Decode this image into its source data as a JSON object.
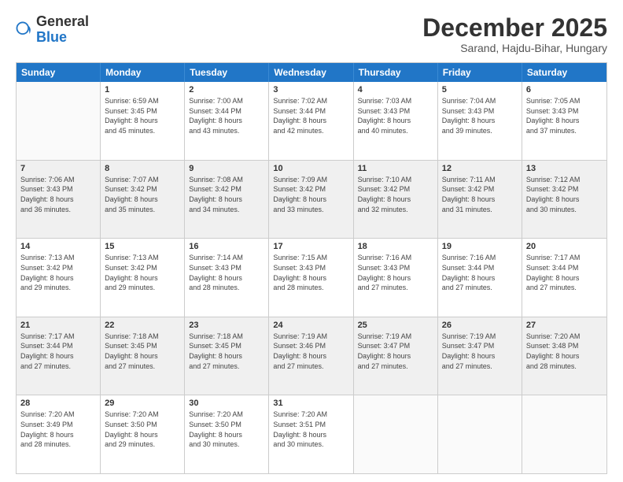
{
  "logo": {
    "general": "General",
    "blue": "Blue"
  },
  "header": {
    "month": "December 2025",
    "location": "Sarand, Hajdu-Bihar, Hungary"
  },
  "weekdays": [
    "Sunday",
    "Monday",
    "Tuesday",
    "Wednesday",
    "Thursday",
    "Friday",
    "Saturday"
  ],
  "weeks": [
    [
      {
        "day": "",
        "info": ""
      },
      {
        "day": "1",
        "info": "Sunrise: 6:59 AM\nSunset: 3:45 PM\nDaylight: 8 hours\nand 45 minutes."
      },
      {
        "day": "2",
        "info": "Sunrise: 7:00 AM\nSunset: 3:44 PM\nDaylight: 8 hours\nand 43 minutes."
      },
      {
        "day": "3",
        "info": "Sunrise: 7:02 AM\nSunset: 3:44 PM\nDaylight: 8 hours\nand 42 minutes."
      },
      {
        "day": "4",
        "info": "Sunrise: 7:03 AM\nSunset: 3:43 PM\nDaylight: 8 hours\nand 40 minutes."
      },
      {
        "day": "5",
        "info": "Sunrise: 7:04 AM\nSunset: 3:43 PM\nDaylight: 8 hours\nand 39 minutes."
      },
      {
        "day": "6",
        "info": "Sunrise: 7:05 AM\nSunset: 3:43 PM\nDaylight: 8 hours\nand 37 minutes."
      }
    ],
    [
      {
        "day": "7",
        "info": "Sunrise: 7:06 AM\nSunset: 3:43 PM\nDaylight: 8 hours\nand 36 minutes."
      },
      {
        "day": "8",
        "info": "Sunrise: 7:07 AM\nSunset: 3:42 PM\nDaylight: 8 hours\nand 35 minutes."
      },
      {
        "day": "9",
        "info": "Sunrise: 7:08 AM\nSunset: 3:42 PM\nDaylight: 8 hours\nand 34 minutes."
      },
      {
        "day": "10",
        "info": "Sunrise: 7:09 AM\nSunset: 3:42 PM\nDaylight: 8 hours\nand 33 minutes."
      },
      {
        "day": "11",
        "info": "Sunrise: 7:10 AM\nSunset: 3:42 PM\nDaylight: 8 hours\nand 32 minutes."
      },
      {
        "day": "12",
        "info": "Sunrise: 7:11 AM\nSunset: 3:42 PM\nDaylight: 8 hours\nand 31 minutes."
      },
      {
        "day": "13",
        "info": "Sunrise: 7:12 AM\nSunset: 3:42 PM\nDaylight: 8 hours\nand 30 minutes."
      }
    ],
    [
      {
        "day": "14",
        "info": "Sunrise: 7:13 AM\nSunset: 3:42 PM\nDaylight: 8 hours\nand 29 minutes."
      },
      {
        "day": "15",
        "info": "Sunrise: 7:13 AM\nSunset: 3:42 PM\nDaylight: 8 hours\nand 29 minutes."
      },
      {
        "day": "16",
        "info": "Sunrise: 7:14 AM\nSunset: 3:43 PM\nDaylight: 8 hours\nand 28 minutes."
      },
      {
        "day": "17",
        "info": "Sunrise: 7:15 AM\nSunset: 3:43 PM\nDaylight: 8 hours\nand 28 minutes."
      },
      {
        "day": "18",
        "info": "Sunrise: 7:16 AM\nSunset: 3:43 PM\nDaylight: 8 hours\nand 27 minutes."
      },
      {
        "day": "19",
        "info": "Sunrise: 7:16 AM\nSunset: 3:44 PM\nDaylight: 8 hours\nand 27 minutes."
      },
      {
        "day": "20",
        "info": "Sunrise: 7:17 AM\nSunset: 3:44 PM\nDaylight: 8 hours\nand 27 minutes."
      }
    ],
    [
      {
        "day": "21",
        "info": "Sunrise: 7:17 AM\nSunset: 3:44 PM\nDaylight: 8 hours\nand 27 minutes."
      },
      {
        "day": "22",
        "info": "Sunrise: 7:18 AM\nSunset: 3:45 PM\nDaylight: 8 hours\nand 27 minutes."
      },
      {
        "day": "23",
        "info": "Sunrise: 7:18 AM\nSunset: 3:45 PM\nDaylight: 8 hours\nand 27 minutes."
      },
      {
        "day": "24",
        "info": "Sunrise: 7:19 AM\nSunset: 3:46 PM\nDaylight: 8 hours\nand 27 minutes."
      },
      {
        "day": "25",
        "info": "Sunrise: 7:19 AM\nSunset: 3:47 PM\nDaylight: 8 hours\nand 27 minutes."
      },
      {
        "day": "26",
        "info": "Sunrise: 7:19 AM\nSunset: 3:47 PM\nDaylight: 8 hours\nand 27 minutes."
      },
      {
        "day": "27",
        "info": "Sunrise: 7:20 AM\nSunset: 3:48 PM\nDaylight: 8 hours\nand 28 minutes."
      }
    ],
    [
      {
        "day": "28",
        "info": "Sunrise: 7:20 AM\nSunset: 3:49 PM\nDaylight: 8 hours\nand 28 minutes."
      },
      {
        "day": "29",
        "info": "Sunrise: 7:20 AM\nSunset: 3:50 PM\nDaylight: 8 hours\nand 29 minutes."
      },
      {
        "day": "30",
        "info": "Sunrise: 7:20 AM\nSunset: 3:50 PM\nDaylight: 8 hours\nand 30 minutes."
      },
      {
        "day": "31",
        "info": "Sunrise: 7:20 AM\nSunset: 3:51 PM\nDaylight: 8 hours\nand 30 minutes."
      },
      {
        "day": "",
        "info": ""
      },
      {
        "day": "",
        "info": ""
      },
      {
        "day": "",
        "info": ""
      }
    ]
  ]
}
